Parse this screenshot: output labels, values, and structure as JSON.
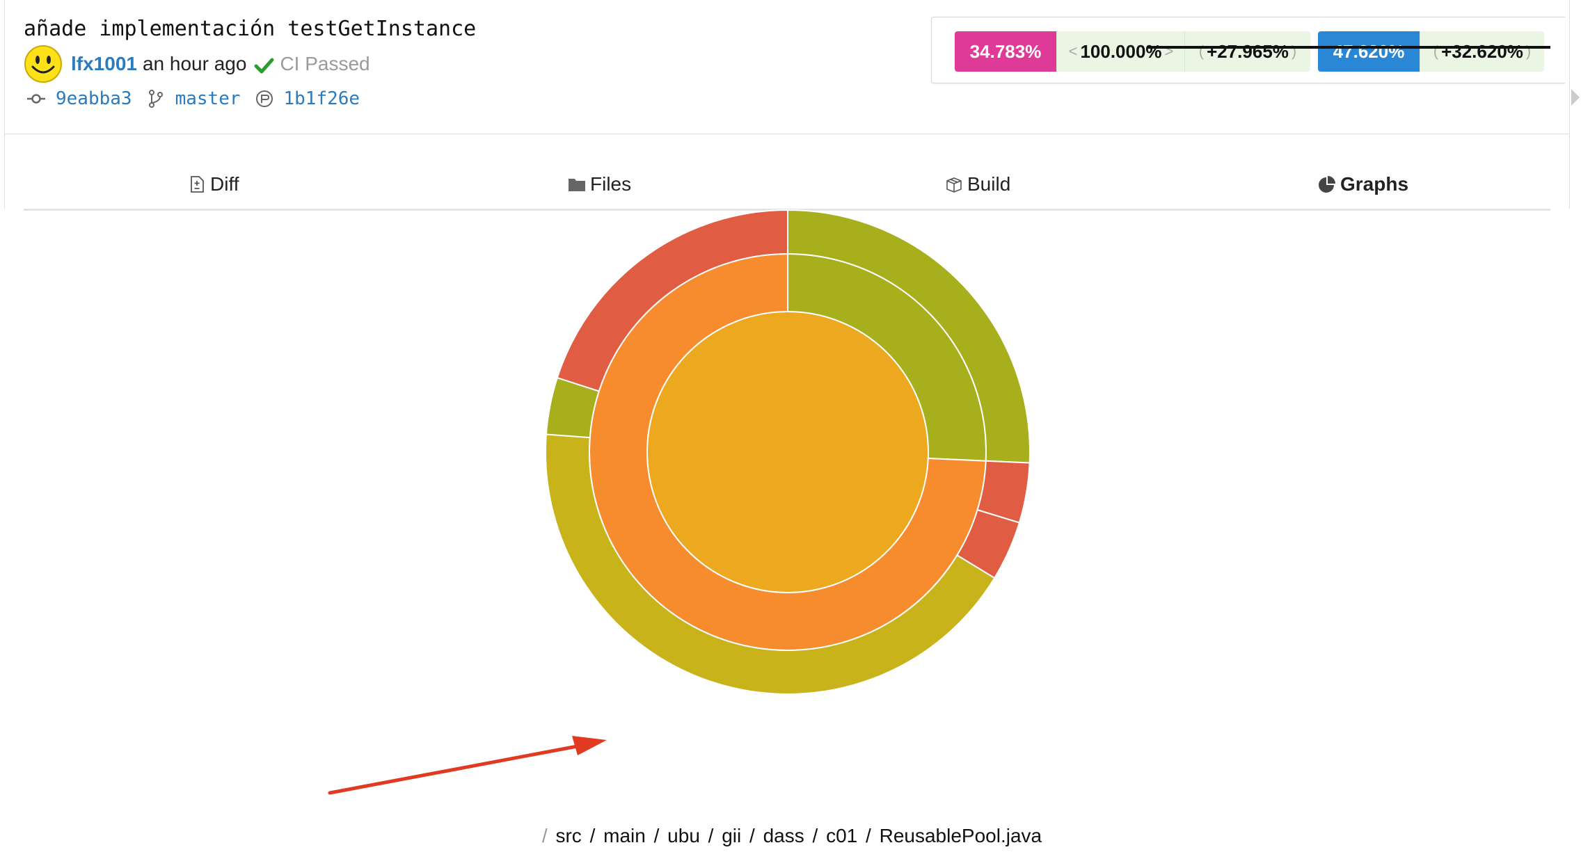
{
  "commit": {
    "message": "añade implementación testGetInstance",
    "author": "lfx1001",
    "time": "an hour ago",
    "ci_status": "CI Passed",
    "sha": "9eabba3",
    "branch": "master",
    "parent_sha": "1b1f26e"
  },
  "coverage": {
    "primary": "34.783%",
    "patch": "100.000%",
    "change": "+27.965%",
    "secondary": "47.620%",
    "secondary_change": "+32.620%",
    "primary_color": "#e03a98",
    "secondary_color": "#2a87d5"
  },
  "tabs": [
    {
      "label": "Diff",
      "icon": "file-diff-icon"
    },
    {
      "label": "Files",
      "icon": "folder-icon"
    },
    {
      "label": "Build",
      "icon": "package-icon"
    },
    {
      "label": "Graphs",
      "icon": "pie-chart-icon",
      "active": true
    }
  ],
  "breadcrumb": [
    "src",
    "main",
    "ubu",
    "gii",
    "dass",
    "c01",
    "ReusablePool.java"
  ],
  "chart_data": {
    "type": "sunburst",
    "rings": [
      {
        "level": 0,
        "segments": [
          {
            "share": 1.0,
            "color": "#eca81e"
          }
        ]
      },
      {
        "level": 1,
        "segments": [
          {
            "share": 0.2571,
            "color": "#a7af1c"
          },
          {
            "share": 0.7429,
            "color": "#f78c2f"
          }
        ]
      },
      {
        "level": 2,
        "segments": [
          {
            "share": 0.2571,
            "color": "#a7af1c"
          },
          {
            "share": 0.04,
            "color": "#e05c42"
          },
          {
            "share": 0.04,
            "color": "#e05c42"
          },
          {
            "share": 0.4246,
            "color": "#c9b31a"
          },
          {
            "share": 0.038,
            "color": "#a7af1c"
          },
          {
            "share": 0.2003,
            "color": "#e05c42"
          }
        ]
      }
    ]
  }
}
